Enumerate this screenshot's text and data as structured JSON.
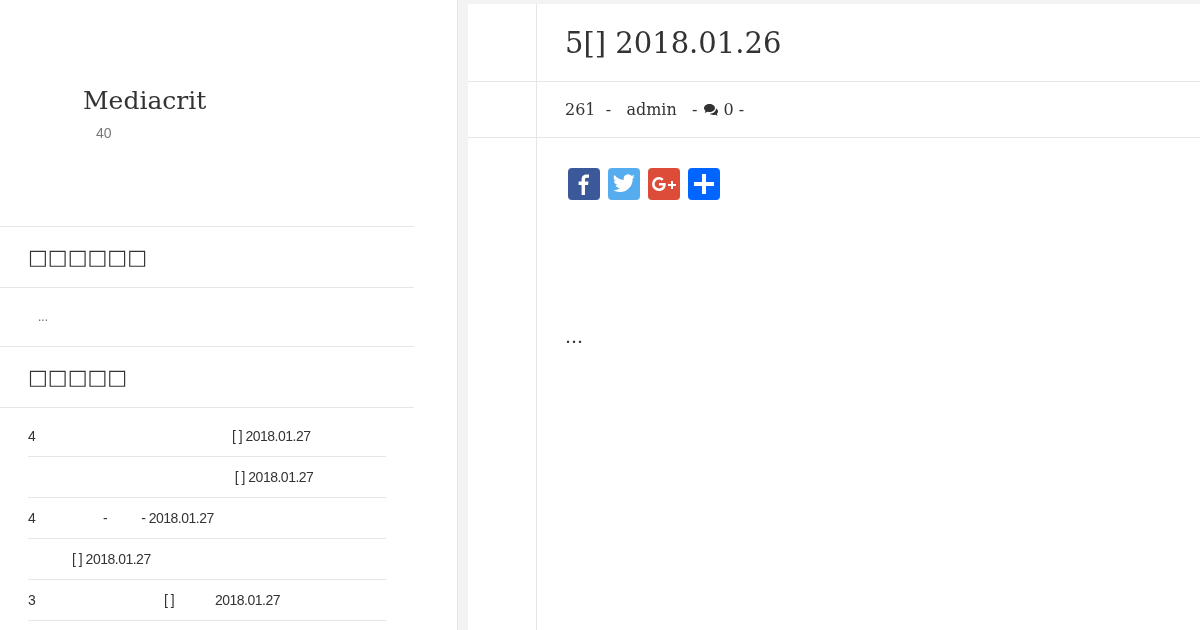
{
  "site": {
    "title": "Mediacrit",
    "subtitle": "40"
  },
  "widgets": [
    {
      "title": "□□□□□□",
      "kind": "text",
      "body": "..."
    },
    {
      "title": "□□□□□",
      "kind": "posts",
      "posts": [
        "4                                                          [ ] 2018.01.27",
        "                                                             [ ] 2018.01.27",
        "4                    -          - 2018.01.27",
        "             [ ] 2018.01.27",
        "3                                      [ ]            2018.01.27"
      ]
    }
  ],
  "post": {
    "title": "5[] 2018.01.26",
    "meta_text": "261  -   admin   -",
    "comment_count": "0",
    "meta_end": "-",
    "share": [
      {
        "kind": "facebook"
      },
      {
        "kind": "twitter"
      },
      {
        "kind": "google-plus"
      },
      {
        "kind": "share"
      }
    ],
    "body": "..."
  }
}
